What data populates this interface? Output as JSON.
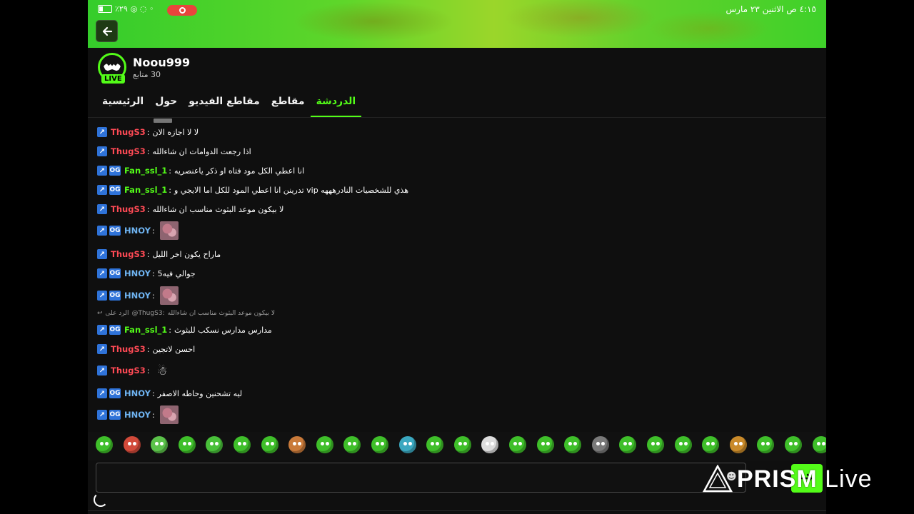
{
  "status_bar": {
    "time": "٤:١٥ ص  الاثنين ٢٣ مارس",
    "battery": "٪٢٩"
  },
  "channel": {
    "name": "Noou999",
    "followers": "30 متابع",
    "live_badge": "LIVE"
  },
  "tabs": [
    {
      "label": "الرئيسية"
    },
    {
      "label": "حول"
    },
    {
      "label": "مقاطع الفيديو"
    },
    {
      "label": "مقاطع"
    },
    {
      "label": "الدردشة",
      "active": true
    }
  ],
  "chat": {
    "messages": [
      {
        "user": "ThugS3",
        "color": "#ff4a55",
        "text": "لا لا اجازه الان",
        "badges": [
          "mod"
        ]
      },
      {
        "user": "ThugS3",
        "color": "#ff4a55",
        "text": "اذا رجعت الدوامات ان شاءالله",
        "badges": [
          "mod"
        ]
      },
      {
        "user": "Fan_ssl_1",
        "color": "#53fc18",
        "text": "انا اعطي الكل مود فتاه او ذكر ياعنصريه",
        "badges": [
          "mod",
          "og"
        ]
      },
      {
        "user": "Fan_ssl_1",
        "color": "#53fc18",
        "text": "هذي للشخصيات النادرهههه vip تدرينن انا اعطي المود للكل اما الايجي و",
        "badges": [
          "mod",
          "og"
        ]
      },
      {
        "user": "ThugS3",
        "color": "#ff4a55",
        "text": "لا بيكون موعد البثوث مناسب ان شاءالله",
        "badges": [
          "mod"
        ]
      },
      {
        "user": "HNOY",
        "color": "#6fb4f2",
        "text": "",
        "badges": [
          "mod",
          "og"
        ],
        "image": true
      },
      {
        "user": "ThugS3",
        "color": "#ff4a55",
        "text": "ماراح يكون اخر الليل",
        "badges": [
          "mod"
        ]
      },
      {
        "user": "HNOY",
        "color": "#6fb4f2",
        "text": "جوالي فيه5",
        "badges": [
          "mod",
          "og"
        ]
      },
      {
        "user": "HNOY",
        "color": "#6fb4f2",
        "text": "",
        "badges": [
          "mod",
          "og"
        ],
        "image": true
      },
      {
        "user": "Fan_ssl_1",
        "color": "#53fc18",
        "text": "مدارس مدارس نسكب للبثوث",
        "badges": [
          "mod",
          "og"
        ]
      },
      {
        "user": "ThugS3",
        "color": "#ff4a55",
        "text": "احسن لاتجين",
        "badges": [
          "mod"
        ]
      },
      {
        "user": "ThugS3",
        "color": "#ff4a55",
        "text": "",
        "badges": [
          "mod"
        ],
        "emote": true
      },
      {
        "user": "HNOY",
        "color": "#6fb4f2",
        "text": "ليه تشحنين وحاطه الاصفر",
        "badges": [
          "mod",
          "og"
        ]
      },
      {
        "user": "HNOY",
        "color": "#6fb4f2",
        "text": "",
        "badges": [
          "mod",
          "og"
        ],
        "image": true
      }
    ],
    "reply": {
      "prefix": "الرد على",
      "mention": "@ThugS3:",
      "text": "لا بيكون موعد البثوث مناسب ان شاءالله"
    }
  },
  "emote_count": 27,
  "input": {
    "value": "",
    "placeholder": ""
  },
  "watermark": {
    "brand": "PRISM",
    "suffix": "Live"
  },
  "colors": {
    "accent": "#53fc18",
    "mod_badge": "#2f73d9"
  },
  "icons": {
    "back": "arrow-left-icon",
    "send": "send-icon",
    "emoji": "emoji-icon"
  }
}
